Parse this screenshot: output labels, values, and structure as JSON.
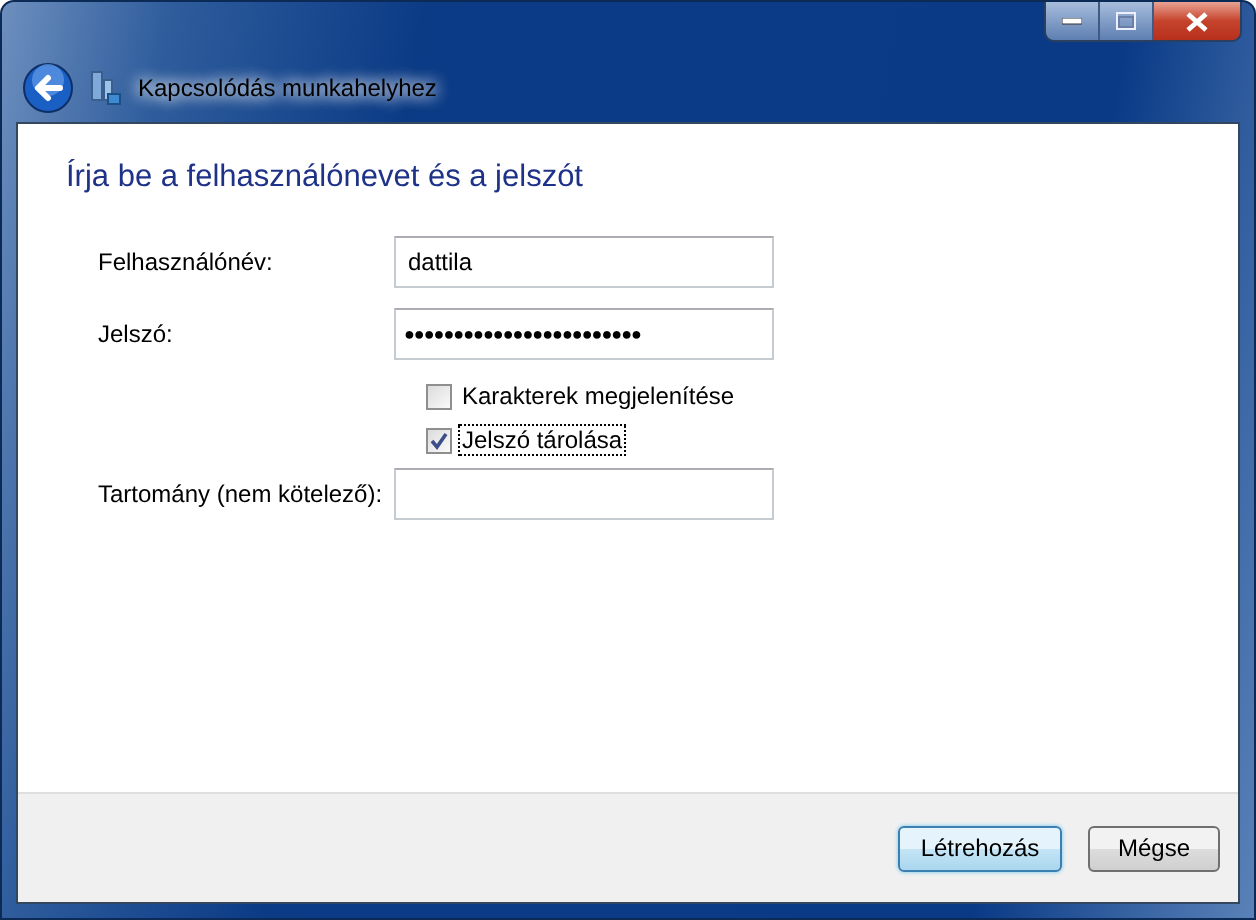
{
  "window": {
    "title": "Kapcsolódás munkahelyhez"
  },
  "heading": "Írja be a felhasználónevet és a jelszót",
  "fields": [
    {
      "label": "Felhasználónév:",
      "value": "dattila"
    },
    {
      "label": "Jelszó:",
      "value": "●●●●●●●●●●●●●●●●●●●●●●●●"
    }
  ],
  "checkboxes": [
    {
      "label": "Karakterek megjelenítése",
      "checked": false,
      "focused": false
    },
    {
      "label": "Jelszó tárolása",
      "checked": true,
      "focused": true
    }
  ],
  "domain_field": {
    "label": "Tartomány (nem kötelező):"
  },
  "buttons": [
    {
      "label": "Létrehozás",
      "default": true
    },
    {
      "label": "Mégse",
      "default": false
    }
  ]
}
